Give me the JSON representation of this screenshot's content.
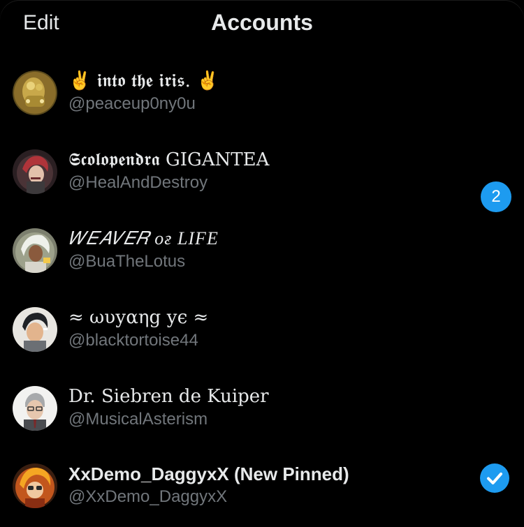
{
  "header": {
    "edit_label": "Edit",
    "title": "Accounts"
  },
  "accounts": [
    {
      "name": "✌️ 𝖎𝖓𝖙𝖔 𝖙𝖍𝖊 𝖎𝖗𝖎𝖘. ✌️",
      "handle": "@peaceup0ny0u",
      "avatar": "gold-figure-avatar"
    },
    {
      "name": "𝕾𝖈𝖔𝖑𝖔𝖕𝖊𝖓𝖉𝖗𝖆 GIGANTEA",
      "handle": "@HealAndDestroy",
      "avatar": "red-hair-avatar"
    },
    {
      "name": "𝑊𝐸𝐴𝑉𝐸𝑅 ᴏғ LIFE",
      "handle": "@BuaTheLotus",
      "avatar": "white-hair-avatar",
      "badge": "2"
    },
    {
      "name": "≈ ωυуαηg ує ≈",
      "handle": "@blacktortoise44",
      "avatar": "dark-hair-avatar"
    },
    {
      "name": "Dr. Siebren de Kuiper",
      "handle": "@MusicalAsterism",
      "avatar": "glasses-man-avatar"
    },
    {
      "name": "XxDemo_DaggyxX (New Pinned)",
      "handle": "@XxDemo_DaggyxX",
      "avatar": "orange-flame-avatar",
      "selected": true
    }
  ],
  "colors": {
    "accent": "#1d9bf0",
    "background": "#000000",
    "primary_text": "#e7e9ea",
    "secondary_text": "#71767b"
  }
}
